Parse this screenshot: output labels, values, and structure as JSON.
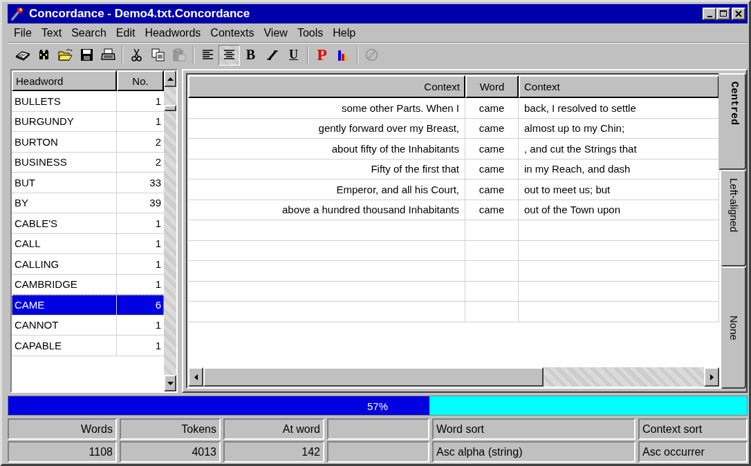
{
  "window": {
    "title": "Concordance - Demo4.txt.Concordance"
  },
  "menu": [
    {
      "label": "File"
    },
    {
      "label": "Text"
    },
    {
      "label": "Search"
    },
    {
      "label": "Edit"
    },
    {
      "label": "Headwords"
    },
    {
      "label": "Contexts"
    },
    {
      "label": "View"
    },
    {
      "label": "Tools"
    },
    {
      "label": "Help"
    }
  ],
  "toolbar": [
    {
      "kind": "icon",
      "pressed": false,
      "disabled": false
    },
    {
      "kind": "icon",
      "pressed": false,
      "disabled": false
    },
    {
      "kind": "icon",
      "pressed": false,
      "disabled": false
    },
    {
      "kind": "icon",
      "pressed": false,
      "disabled": false
    },
    {
      "kind": "icon",
      "pressed": false,
      "disabled": false
    },
    {
      "kind": "separator"
    },
    {
      "kind": "icon",
      "pressed": false,
      "disabled": false
    },
    {
      "kind": "icon",
      "pressed": false,
      "disabled": false
    },
    {
      "kind": "icon",
      "pressed": false,
      "disabled": true
    },
    {
      "kind": "separator"
    },
    {
      "kind": "icon",
      "pressed": false,
      "disabled": false
    },
    {
      "kind": "icon",
      "pressed": true,
      "disabled": false
    },
    {
      "kind": "letter",
      "label": "B",
      "pressed": false,
      "disabled": false
    },
    {
      "kind": "icon",
      "pressed": false,
      "disabled": false
    },
    {
      "kind": "letter",
      "label": "U",
      "pressed": false,
      "disabled": false
    },
    {
      "kind": "separator"
    },
    {
      "kind": "letter",
      "label": "P",
      "pressed": false,
      "disabled": false
    },
    {
      "kind": "icon",
      "pressed": false,
      "disabled": false
    },
    {
      "kind": "separator"
    },
    {
      "kind": "icon",
      "pressed": false,
      "disabled": true
    }
  ],
  "headwords": {
    "columns": [
      "Headword",
      "No."
    ],
    "rows": [
      {
        "word": "BULLETS",
        "count": "1",
        "selected": false
      },
      {
        "word": "BURGUNDY",
        "count": "1",
        "selected": false
      },
      {
        "word": "BURTON",
        "count": "2",
        "selected": false
      },
      {
        "word": "BUSINESS",
        "count": "2",
        "selected": false
      },
      {
        "word": "BUT",
        "count": "33",
        "selected": false
      },
      {
        "word": "BY",
        "count": "39",
        "selected": false
      },
      {
        "word": "CABLE'S",
        "count": "1",
        "selected": false
      },
      {
        "word": "CALL",
        "count": "1",
        "selected": false
      },
      {
        "word": "CALLING",
        "count": "1",
        "selected": false
      },
      {
        "word": "CAMBRIDGE",
        "count": "1",
        "selected": false
      },
      {
        "word": "CAME",
        "count": "6",
        "selected": true
      },
      {
        "word": "CANNOT",
        "count": "1",
        "selected": false
      },
      {
        "word": "CAPABLE",
        "count": "1",
        "selected": false
      }
    ]
  },
  "contexts": {
    "columns": [
      "Context",
      "Word",
      "Context"
    ],
    "rows": [
      {
        "left": "some other Parts. When I",
        "word": "came",
        "right": "back, I resolved to settle"
      },
      {
        "left": "gently forward over my Breast,",
        "word": "came",
        "right": "almost up to my Chin;"
      },
      {
        "left": "about fifty of the Inhabitants",
        "word": "came",
        "right": ", and cut the Strings that"
      },
      {
        "left": "Fifty of the first that",
        "word": "came",
        "right": "in my Reach, and dash"
      },
      {
        "left": "Emperor, and all his Court,",
        "word": "came",
        "right": "out to meet us; but"
      },
      {
        "left": "above a hundred thousand Inhabitants",
        "word": "came",
        "right": "out of the Town upon"
      }
    ]
  },
  "alignment_tabs": [
    {
      "label": "Centred",
      "selected": true
    },
    {
      "label": "Left-aligned",
      "selected": false
    },
    {
      "label": "None",
      "selected": false
    }
  ],
  "progress": {
    "level": 0.57,
    "reading": "57%"
  },
  "status_bar": {
    "rows": [
      {
        "cells": [
          {
            "text": "Words"
          },
          {
            "text": "Tokens"
          },
          {
            "text": "At word"
          },
          {},
          {
            "text": "Word sort"
          },
          {
            "text": "Context sort"
          }
        ]
      },
      {
        "cells": [
          {
            "text": "1108"
          },
          {
            "text": "4013"
          },
          {
            "text": "142"
          },
          {},
          {
            "text": "Asc alpha (string)"
          },
          {
            "text": "Asc occurrer"
          }
        ]
      }
    ]
  }
}
